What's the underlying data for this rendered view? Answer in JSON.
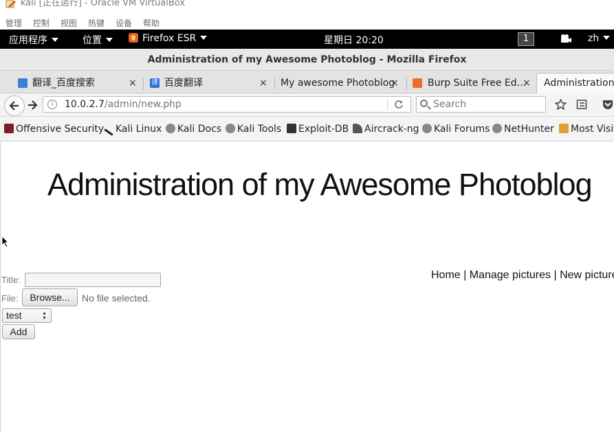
{
  "vbox": {
    "title": "kali [正在运行] - Oracle VM VirtualBox",
    "menu": [
      "管理",
      "控制",
      "视图",
      "热键",
      "设备",
      "帮助"
    ]
  },
  "gnome": {
    "applications": "应用程序",
    "places": "位置",
    "firefox": "Firefox ESR",
    "clock": "星期日 20:20",
    "workspace": "1",
    "lang": "zh"
  },
  "window": {
    "title": "Administration of my Awesome Photoblog - Mozilla Firefox"
  },
  "tabs": [
    {
      "label": "翻译_百度搜索",
      "close": "×"
    },
    {
      "label": "百度翻译",
      "close": "×"
    },
    {
      "label": "My awesome Photoblog",
      "close": "×"
    },
    {
      "label": "Burp Suite Free Ed…",
      "close": "×"
    },
    {
      "label": "Administration o"
    }
  ],
  "url": {
    "host": "10.0.2.7",
    "path": "/admin/new.php"
  },
  "search": {
    "placeholder": "Search"
  },
  "bookmarks": [
    "Offensive Security",
    "Kali Linux",
    "Kali Docs",
    "Kali Tools",
    "Exploit-DB",
    "Aircrack-ng",
    "Kali Forums",
    "NetHunter",
    "Most Visit"
  ],
  "page": {
    "heading": "Administration of my Awesome Photoblog",
    "nav": "Home |  Manage pictures |  New picture",
    "title_label": "Title:",
    "title_value": "",
    "file_label": "File:",
    "browse": "Browse...",
    "no_file": "No file selected.",
    "category": "test",
    "add": "Add"
  },
  "colors": {
    "gnome_bar": "#000000",
    "firefox_logo": "#e8602a"
  }
}
